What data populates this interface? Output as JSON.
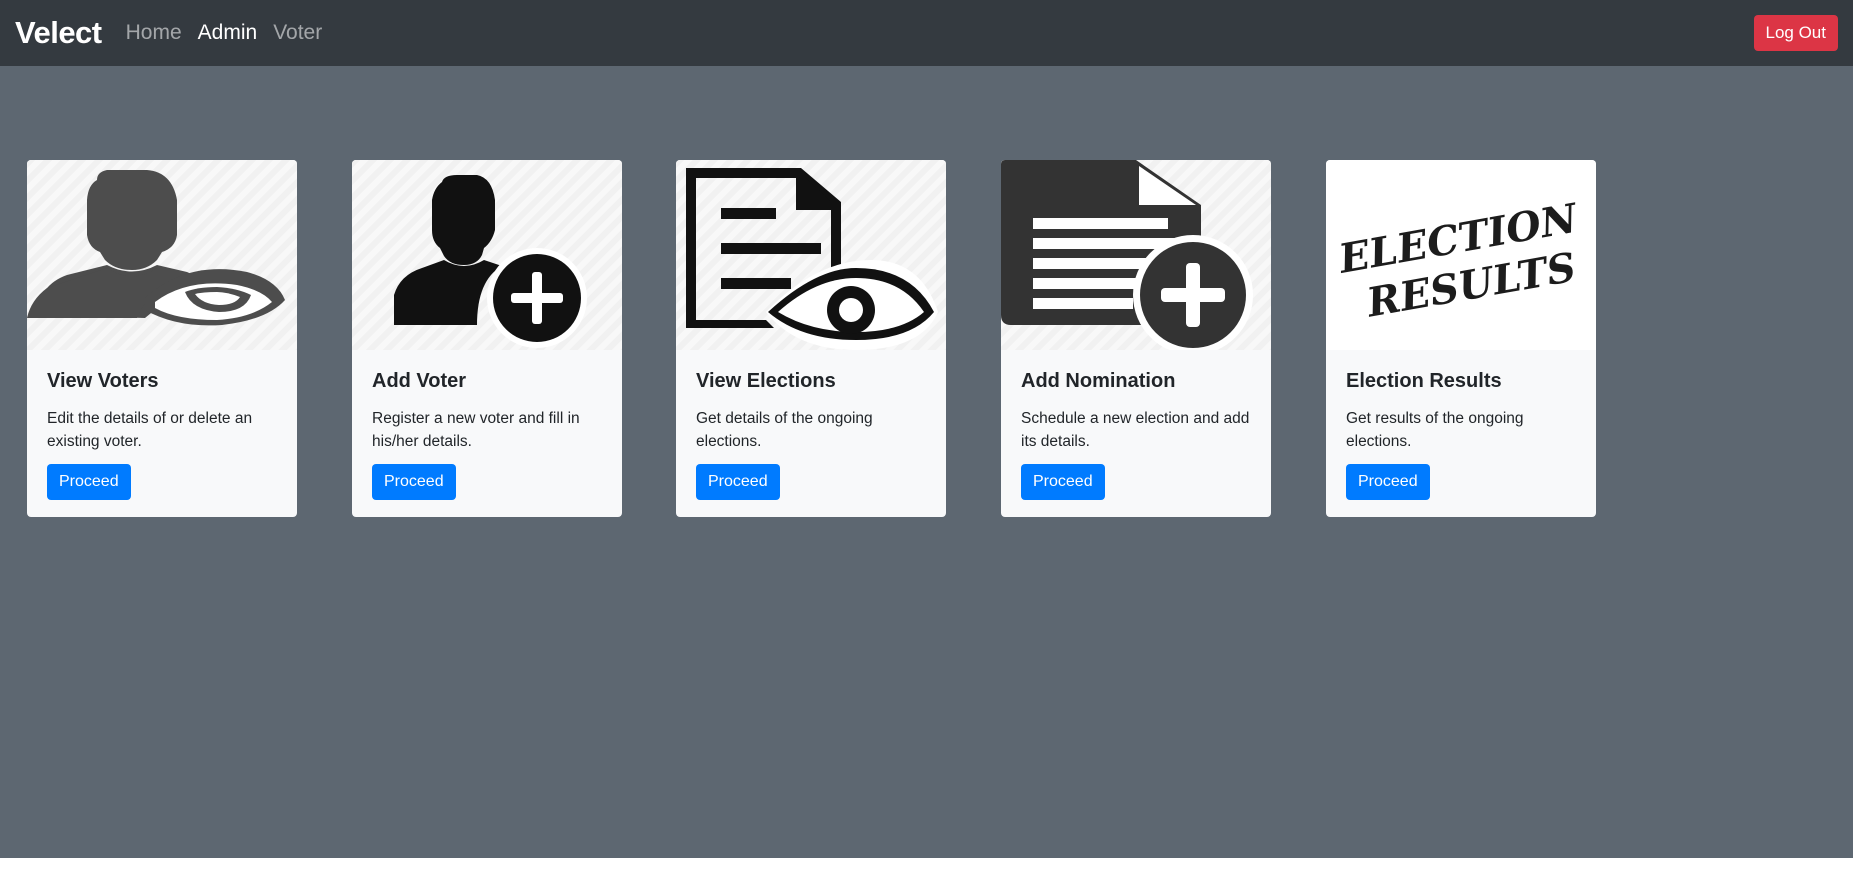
{
  "navbar": {
    "brand": "Velect",
    "links": [
      {
        "label": "Home",
        "active": false
      },
      {
        "label": "Admin",
        "active": true
      },
      {
        "label": "Voter",
        "active": false
      }
    ],
    "logout_label": "Log Out",
    "logout_color": "#dc3545"
  },
  "cards": [
    {
      "title": "View Voters",
      "text": "Edit the details of or delete an existing voter.",
      "button": "Proceed",
      "icon": "user-eye-icon"
    },
    {
      "title": "Add Voter",
      "text": "Register a new voter and fill in his/her details.",
      "button": "Proceed",
      "icon": "user-add-icon"
    },
    {
      "title": "View Elections",
      "text": "Get details of the ongoing elections.",
      "button": "Proceed",
      "icon": "document-eye-icon"
    },
    {
      "title": "Add Nomination",
      "text": "Schedule a new election and add its details.",
      "button": "Proceed",
      "icon": "document-add-icon"
    },
    {
      "title": "Election Results",
      "text": "Get results of the ongoing elections.",
      "button": "Proceed",
      "icon": "election-results-stamp",
      "image_text_line1": "ELECTION",
      "image_text_line2": "RESULTS"
    }
  ],
  "colors": {
    "navbar_bg": "#343a40",
    "page_bg": "#5d6771",
    "primary": "#007bff",
    "card_bg": "#f8f9fa"
  }
}
